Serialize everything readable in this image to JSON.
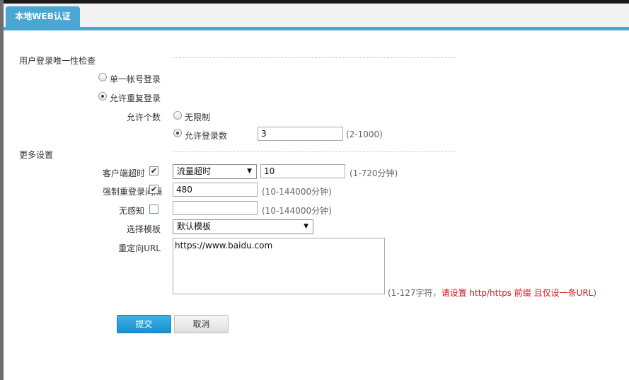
{
  "tab": {
    "title": "本地WEB认证"
  },
  "unique_login": {
    "section_title": "用户登录唯一性检查",
    "single_account": "单一帐号登录",
    "allow_repeat": "允许重复登录",
    "count_label": "允许个数",
    "unlimited": "无限制",
    "allow_count": "允许登录数",
    "count_value": "3",
    "count_range": "(2-1000)"
  },
  "more": {
    "section_title": "更多设置",
    "client_timeout": {
      "label": "客户端超时",
      "checked": true,
      "mode": "流量超时",
      "value": "10",
      "range": "(1-720分钟)"
    },
    "force_relogin": {
      "label": "强制重登录间隔",
      "checked": true,
      "value": "480",
      "range": "(10-144000分钟)"
    },
    "seamless": {
      "label": "无感知",
      "checked": false,
      "value": "",
      "range": "(10-144000分钟)"
    },
    "template": {
      "label": "选择模板",
      "value": "默认模板"
    },
    "redirect": {
      "label": "重定向URL",
      "value": "https://www.baidu.com",
      "hint_prefix": "(1-127字符，",
      "hint_red": "请设置 http/https 前缀 且仅设一条URL",
      "hint_suffix": ")"
    }
  },
  "buttons": {
    "submit": "提交",
    "cancel": "取消"
  }
}
